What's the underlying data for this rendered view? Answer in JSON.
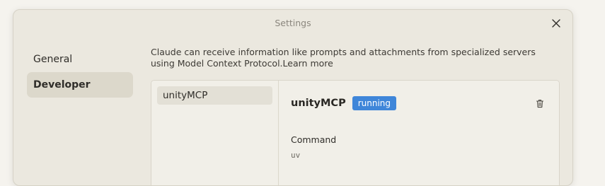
{
  "dialog": {
    "title": "Settings"
  },
  "nav": {
    "items": [
      {
        "label": "General",
        "active": false
      },
      {
        "label": "Developer",
        "active": true
      }
    ]
  },
  "developer": {
    "description": "Claude can receive information like prompts and attachments from specialized servers using Model Context Protocol.",
    "learn_more": "Learn more",
    "servers": [
      {
        "name": "unityMCP"
      }
    ],
    "selected": {
      "name": "unityMCP",
      "status": "running",
      "command_label": "Command",
      "command_value": "uv"
    }
  },
  "colors": {
    "status_running": "#3f86d9",
    "nav_active_bg": "#dcd8cb",
    "window_bg": "#ebe8df"
  },
  "icons": {
    "close": "close-icon",
    "delete": "trash-icon"
  }
}
